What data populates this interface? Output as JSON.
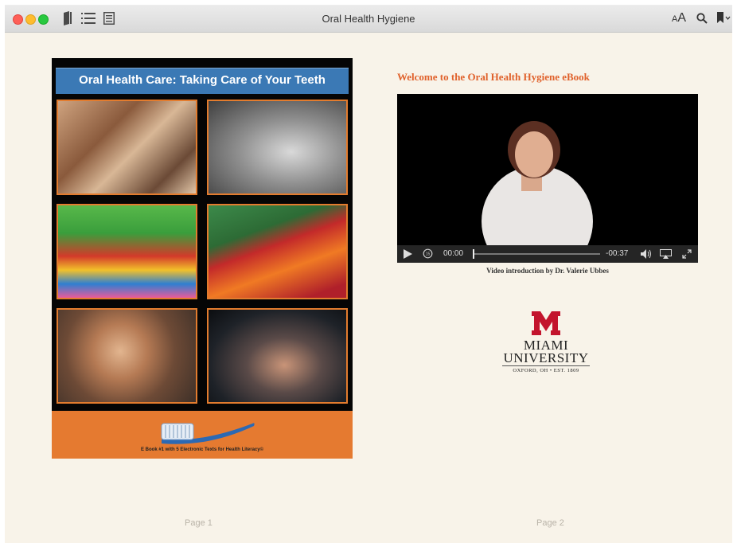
{
  "window": {
    "title": "Oral Health Hygiene",
    "font_size_icon": "AA"
  },
  "cover": {
    "title": "Oral Health Care: Taking Care of Your Teeth",
    "subtitle": "E Book #1 with 5 Electronic Texts for Health Literacy©"
  },
  "welcome": "Welcome to the Oral Health Hygiene eBook",
  "video": {
    "current_time": "00:00",
    "remaining_time": "-00:37",
    "caption": "Video introduction by Dr. Valerie Ubbes"
  },
  "logo": {
    "line1": "MIAMI",
    "line2": "UNIVERSITY",
    "line3": "OXFORD, OH • EST. 1809"
  },
  "pages": {
    "left": "Page 1",
    "right": "Page 2"
  },
  "colors": {
    "accent_orange": "#e57a30",
    "banner_blue": "#3b79b5",
    "welcome_text": "#e0612b",
    "logo_red": "#c3142d"
  }
}
